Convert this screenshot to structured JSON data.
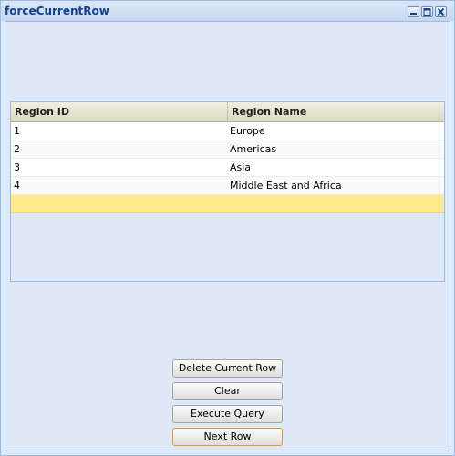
{
  "window": {
    "title": "forceCurrentRow",
    "tools": [
      "minimize-icon",
      "maximize-icon",
      "close-icon"
    ]
  },
  "grid": {
    "columns": [
      "Region ID",
      "Region Name"
    ],
    "rows": [
      {
        "id": "1",
        "name": "Europe"
      },
      {
        "id": "2",
        "name": "Americas"
      },
      {
        "id": "3",
        "name": "Asia"
      },
      {
        "id": "4",
        "name": "Middle East and Africa"
      },
      {
        "id": "",
        "name": "",
        "selected": true
      }
    ]
  },
  "buttons": {
    "delete_label": "Delete Current Row",
    "clear_label": "Clear",
    "execute_label": "Execute Query",
    "next_label": "Next Row"
  },
  "colors": {
    "title_text": "#15428b",
    "panel_bg": "#dfe8f6",
    "border": "#99bbe8",
    "selected_row": "#feeb8f",
    "focused_button_border": "#e59a30"
  }
}
